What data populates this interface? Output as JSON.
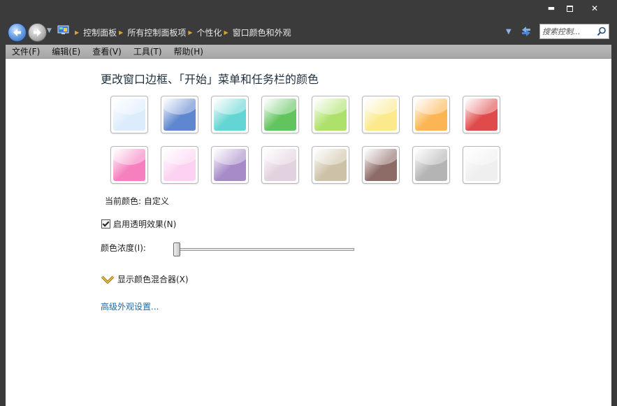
{
  "window": {
    "controls": {
      "minimize": "▬",
      "close": "✕"
    }
  },
  "address": {
    "breadcrumb": [
      "控制面板",
      "所有控制面板项",
      "个性化",
      "窗口颜色和外观"
    ],
    "search_placeholder": "搜索控制..."
  },
  "menu": [
    "文件(F)",
    "编辑(E)",
    "查看(V)",
    "工具(T)",
    "帮助(H)"
  ],
  "main": {
    "title": "更改窗口边框、「开始」菜单和任务栏的颜色",
    "swatches": [
      {
        "color": "#dcecfc"
      },
      {
        "color": "#5f87cf"
      },
      {
        "color": "#63d5d3"
      },
      {
        "color": "#62c45e"
      },
      {
        "color": "#aee16b"
      },
      {
        "color": "#fbe98c"
      },
      {
        "color": "#fcb553"
      },
      {
        "color": "#df4b4b"
      },
      {
        "color": "#f57fbf"
      },
      {
        "color": "#fcd1f1"
      },
      {
        "color": "#a68bc8"
      },
      {
        "color": "#e2d1de"
      },
      {
        "color": "#cdc2a8"
      },
      {
        "color": "#8d6b67"
      },
      {
        "color": "#b4b4b4"
      },
      {
        "color": "#efefef"
      }
    ],
    "current_color_label": "当前颜色: 自定义",
    "transparency_label": "启用透明效果(N)",
    "transparency_enabled": true,
    "intensity_label": "颜色浓度(I):",
    "intensity_value": 0,
    "mixer_label": "显示颜色混合器(X)",
    "advanced_link": "高级外观设置..."
  }
}
